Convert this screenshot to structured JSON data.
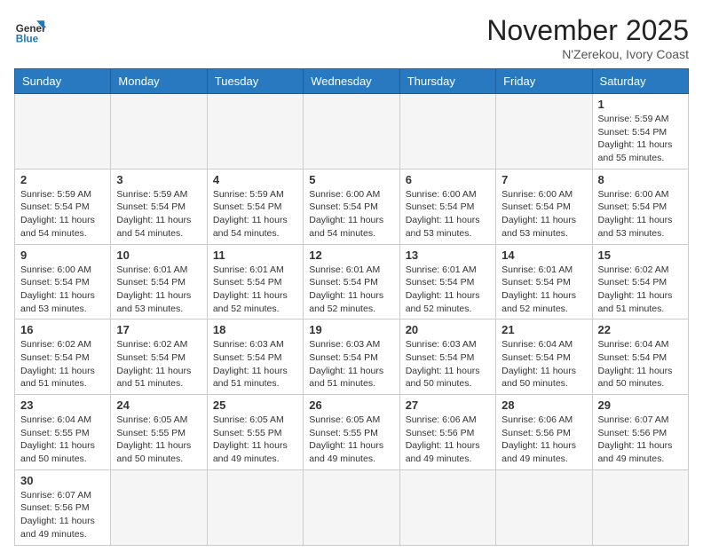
{
  "header": {
    "logo_general": "General",
    "logo_blue": "Blue",
    "month_title": "November 2025",
    "location": "N'Zerekou, Ivory Coast"
  },
  "days_of_week": [
    "Sunday",
    "Monday",
    "Tuesday",
    "Wednesday",
    "Thursday",
    "Friday",
    "Saturday"
  ],
  "weeks": [
    [
      {
        "day": "",
        "info": ""
      },
      {
        "day": "",
        "info": ""
      },
      {
        "day": "",
        "info": ""
      },
      {
        "day": "",
        "info": ""
      },
      {
        "day": "",
        "info": ""
      },
      {
        "day": "",
        "info": ""
      },
      {
        "day": "1",
        "info": "Sunrise: 5:59 AM\nSunset: 5:54 PM\nDaylight: 11 hours\nand 55 minutes."
      }
    ],
    [
      {
        "day": "2",
        "info": "Sunrise: 5:59 AM\nSunset: 5:54 PM\nDaylight: 11 hours\nand 54 minutes."
      },
      {
        "day": "3",
        "info": "Sunrise: 5:59 AM\nSunset: 5:54 PM\nDaylight: 11 hours\nand 54 minutes."
      },
      {
        "day": "4",
        "info": "Sunrise: 5:59 AM\nSunset: 5:54 PM\nDaylight: 11 hours\nand 54 minutes."
      },
      {
        "day": "5",
        "info": "Sunrise: 6:00 AM\nSunset: 5:54 PM\nDaylight: 11 hours\nand 54 minutes."
      },
      {
        "day": "6",
        "info": "Sunrise: 6:00 AM\nSunset: 5:54 PM\nDaylight: 11 hours\nand 53 minutes."
      },
      {
        "day": "7",
        "info": "Sunrise: 6:00 AM\nSunset: 5:54 PM\nDaylight: 11 hours\nand 53 minutes."
      },
      {
        "day": "8",
        "info": "Sunrise: 6:00 AM\nSunset: 5:54 PM\nDaylight: 11 hours\nand 53 minutes."
      }
    ],
    [
      {
        "day": "9",
        "info": "Sunrise: 6:00 AM\nSunset: 5:54 PM\nDaylight: 11 hours\nand 53 minutes."
      },
      {
        "day": "10",
        "info": "Sunrise: 6:01 AM\nSunset: 5:54 PM\nDaylight: 11 hours\nand 53 minutes."
      },
      {
        "day": "11",
        "info": "Sunrise: 6:01 AM\nSunset: 5:54 PM\nDaylight: 11 hours\nand 52 minutes."
      },
      {
        "day": "12",
        "info": "Sunrise: 6:01 AM\nSunset: 5:54 PM\nDaylight: 11 hours\nand 52 minutes."
      },
      {
        "day": "13",
        "info": "Sunrise: 6:01 AM\nSunset: 5:54 PM\nDaylight: 11 hours\nand 52 minutes."
      },
      {
        "day": "14",
        "info": "Sunrise: 6:01 AM\nSunset: 5:54 PM\nDaylight: 11 hours\nand 52 minutes."
      },
      {
        "day": "15",
        "info": "Sunrise: 6:02 AM\nSunset: 5:54 PM\nDaylight: 11 hours\nand 51 minutes."
      }
    ],
    [
      {
        "day": "16",
        "info": "Sunrise: 6:02 AM\nSunset: 5:54 PM\nDaylight: 11 hours\nand 51 minutes."
      },
      {
        "day": "17",
        "info": "Sunrise: 6:02 AM\nSunset: 5:54 PM\nDaylight: 11 hours\nand 51 minutes."
      },
      {
        "day": "18",
        "info": "Sunrise: 6:03 AM\nSunset: 5:54 PM\nDaylight: 11 hours\nand 51 minutes."
      },
      {
        "day": "19",
        "info": "Sunrise: 6:03 AM\nSunset: 5:54 PM\nDaylight: 11 hours\nand 51 minutes."
      },
      {
        "day": "20",
        "info": "Sunrise: 6:03 AM\nSunset: 5:54 PM\nDaylight: 11 hours\nand 50 minutes."
      },
      {
        "day": "21",
        "info": "Sunrise: 6:04 AM\nSunset: 5:54 PM\nDaylight: 11 hours\nand 50 minutes."
      },
      {
        "day": "22",
        "info": "Sunrise: 6:04 AM\nSunset: 5:54 PM\nDaylight: 11 hours\nand 50 minutes."
      }
    ],
    [
      {
        "day": "23",
        "info": "Sunrise: 6:04 AM\nSunset: 5:55 PM\nDaylight: 11 hours\nand 50 minutes."
      },
      {
        "day": "24",
        "info": "Sunrise: 6:05 AM\nSunset: 5:55 PM\nDaylight: 11 hours\nand 50 minutes."
      },
      {
        "day": "25",
        "info": "Sunrise: 6:05 AM\nSunset: 5:55 PM\nDaylight: 11 hours\nand 49 minutes."
      },
      {
        "day": "26",
        "info": "Sunrise: 6:05 AM\nSunset: 5:55 PM\nDaylight: 11 hours\nand 49 minutes."
      },
      {
        "day": "27",
        "info": "Sunrise: 6:06 AM\nSunset: 5:56 PM\nDaylight: 11 hours\nand 49 minutes."
      },
      {
        "day": "28",
        "info": "Sunrise: 6:06 AM\nSunset: 5:56 PM\nDaylight: 11 hours\nand 49 minutes."
      },
      {
        "day": "29",
        "info": "Sunrise: 6:07 AM\nSunset: 5:56 PM\nDaylight: 11 hours\nand 49 minutes."
      }
    ],
    [
      {
        "day": "30",
        "info": "Sunrise: 6:07 AM\nSunset: 5:56 PM\nDaylight: 11 hours\nand 49 minutes."
      },
      {
        "day": "",
        "info": ""
      },
      {
        "day": "",
        "info": ""
      },
      {
        "day": "",
        "info": ""
      },
      {
        "day": "",
        "info": ""
      },
      {
        "day": "",
        "info": ""
      },
      {
        "day": "",
        "info": ""
      }
    ]
  ]
}
